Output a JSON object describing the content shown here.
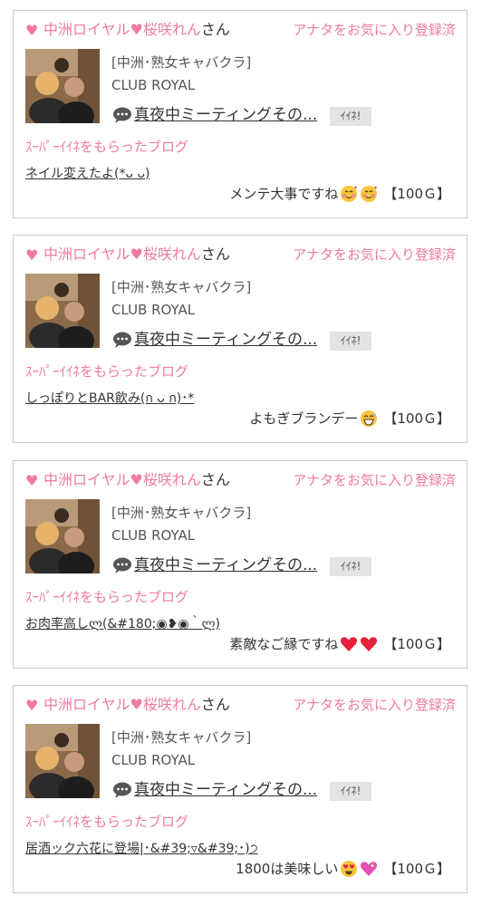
{
  "cards": [
    {
      "shop": "中洲ロイヤル",
      "cast": "桜咲れん",
      "honorific": "さん",
      "favorite_label": "アナタをお気に入り登録済",
      "category": "[中洲･熟女キャバクラ]",
      "club": "CLUB ROYAL",
      "blog_title": "真夜中ミーティングその...",
      "iine_label": "ｲｲﾈ!",
      "super_label": "ｽｰﾊﾟｰｲｲﾈをもらったブログ",
      "post_title": "ネイル変えたよ(*ᴗ ᴗ)",
      "comment": "メンテ大事ですね",
      "emojis": [
        "smiling-hearts-emoji",
        "smiling-hearts-emoji"
      ],
      "reward": "【100Ｇ】"
    },
    {
      "shop": "中洲ロイヤル",
      "cast": "桜咲れん",
      "honorific": "さん",
      "favorite_label": "アナタをお気に入り登録済",
      "category": "[中洲･熟女キャバクラ]",
      "club": "CLUB ROYAL",
      "blog_title": "真夜中ミーティングその...",
      "iine_label": "ｲｲﾈ!",
      "super_label": "ｽｰﾊﾟｰｲｲﾈをもらったブログ",
      "post_title": "しっぽりとBAR飲み(ก ᴗ ก)･*",
      "comment": "よもぎブランデー",
      "emojis": [
        "grinning-sweat-emoji"
      ],
      "reward": "【100Ｇ】"
    },
    {
      "shop": "中洲ロイヤル",
      "cast": "桜咲れん",
      "honorific": "さん",
      "favorite_label": "アナタをお気に入り登録済",
      "category": "[中洲･熟女キャバクラ]",
      "club": "CLUB ROYAL",
      "blog_title": "真夜中ミーティングその...",
      "iine_label": "ｲｲﾈ!",
      "super_label": "ｽｰﾊﾟｰｲｲﾈをもらったブログ",
      "post_title": "お肉率高しლ(&#180;◉❥◉｀ლ)",
      "comment": "素敵なご縁ですね",
      "emojis": [
        "red-heart-emoji",
        "red-heart-emoji"
      ],
      "reward": "【100Ｇ】"
    },
    {
      "shop": "中洲ロイヤル",
      "cast": "桜咲れん",
      "honorific": "さん",
      "favorite_label": "アナタをお気に入り登録済",
      "category": "[中洲･熟女キャバクラ]",
      "club": "CLUB ROYAL",
      "blog_title": "真夜中ミーティングその...",
      "iine_label": "ｲｲﾈ!",
      "super_label": "ｽｰﾊﾟｰｲｲﾈをもらったブログ",
      "post_title": "居酒ック六花に登場|･&#39;▿&#39;･)੭",
      "comment": "1800は美味しい",
      "emojis": [
        "heart-eyes-emoji",
        "sparkling-heart-emoji"
      ],
      "reward": "【100Ｇ】"
    }
  ],
  "colors": {
    "accent_pink": "#f07aa0",
    "text": "#333333",
    "border": "#c9c9c9",
    "button_bg": "#e3e3e3"
  }
}
